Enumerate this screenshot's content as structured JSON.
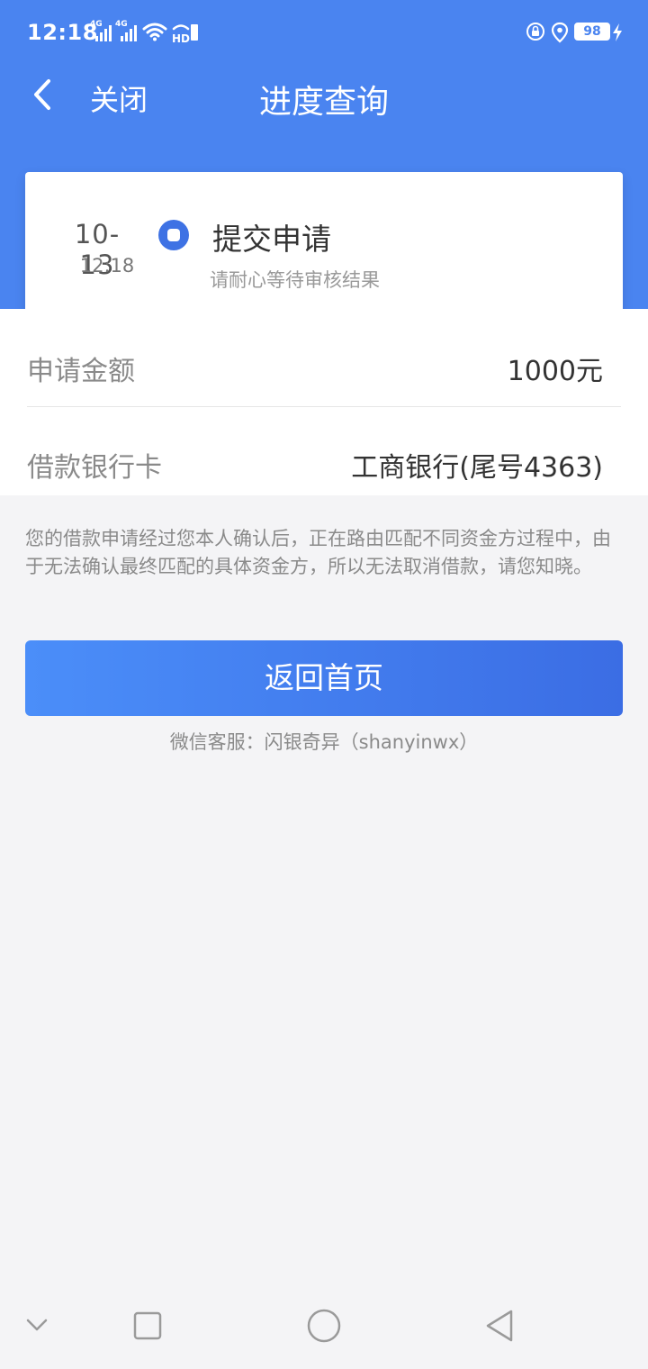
{
  "status_bar": {
    "time": "12:18",
    "signal_1_label": "4G",
    "signal_2_label": "4G",
    "hd_label": "HD",
    "battery": "98",
    "icons": [
      "signal-icon",
      "wifi-icon",
      "hd-icon",
      "rotation-lock-icon",
      "location-icon",
      "battery-icon",
      "charging-icon"
    ]
  },
  "nav": {
    "close_label": "关闭",
    "title": "进度查询"
  },
  "progress": {
    "date": "10-13",
    "time": "12:18",
    "title": "提交申请",
    "description": "请耐心等待审核结果"
  },
  "info": {
    "rows": [
      {
        "label": "申请金额",
        "value": "1000元"
      },
      {
        "label": "借款银行卡",
        "value": "工商银行(尾号4363)"
      }
    ]
  },
  "notice": "您的借款申请经过您本人确认后，正在路由匹配不同资金方过程中，由于无法确认最终匹配的具体资金方，所以无法取消借款，请您知晓。",
  "home_button_label": "返回首页",
  "service_text": "微信客服：闪银奇异（shanyinwx）",
  "colors": {
    "header_blue": "#4a84f0",
    "step_dot": "#3e72e4",
    "button_gradient_start": "#4b8ef9",
    "button_gradient_end": "#3b6de4",
    "page_background": "#f4f4f6"
  }
}
